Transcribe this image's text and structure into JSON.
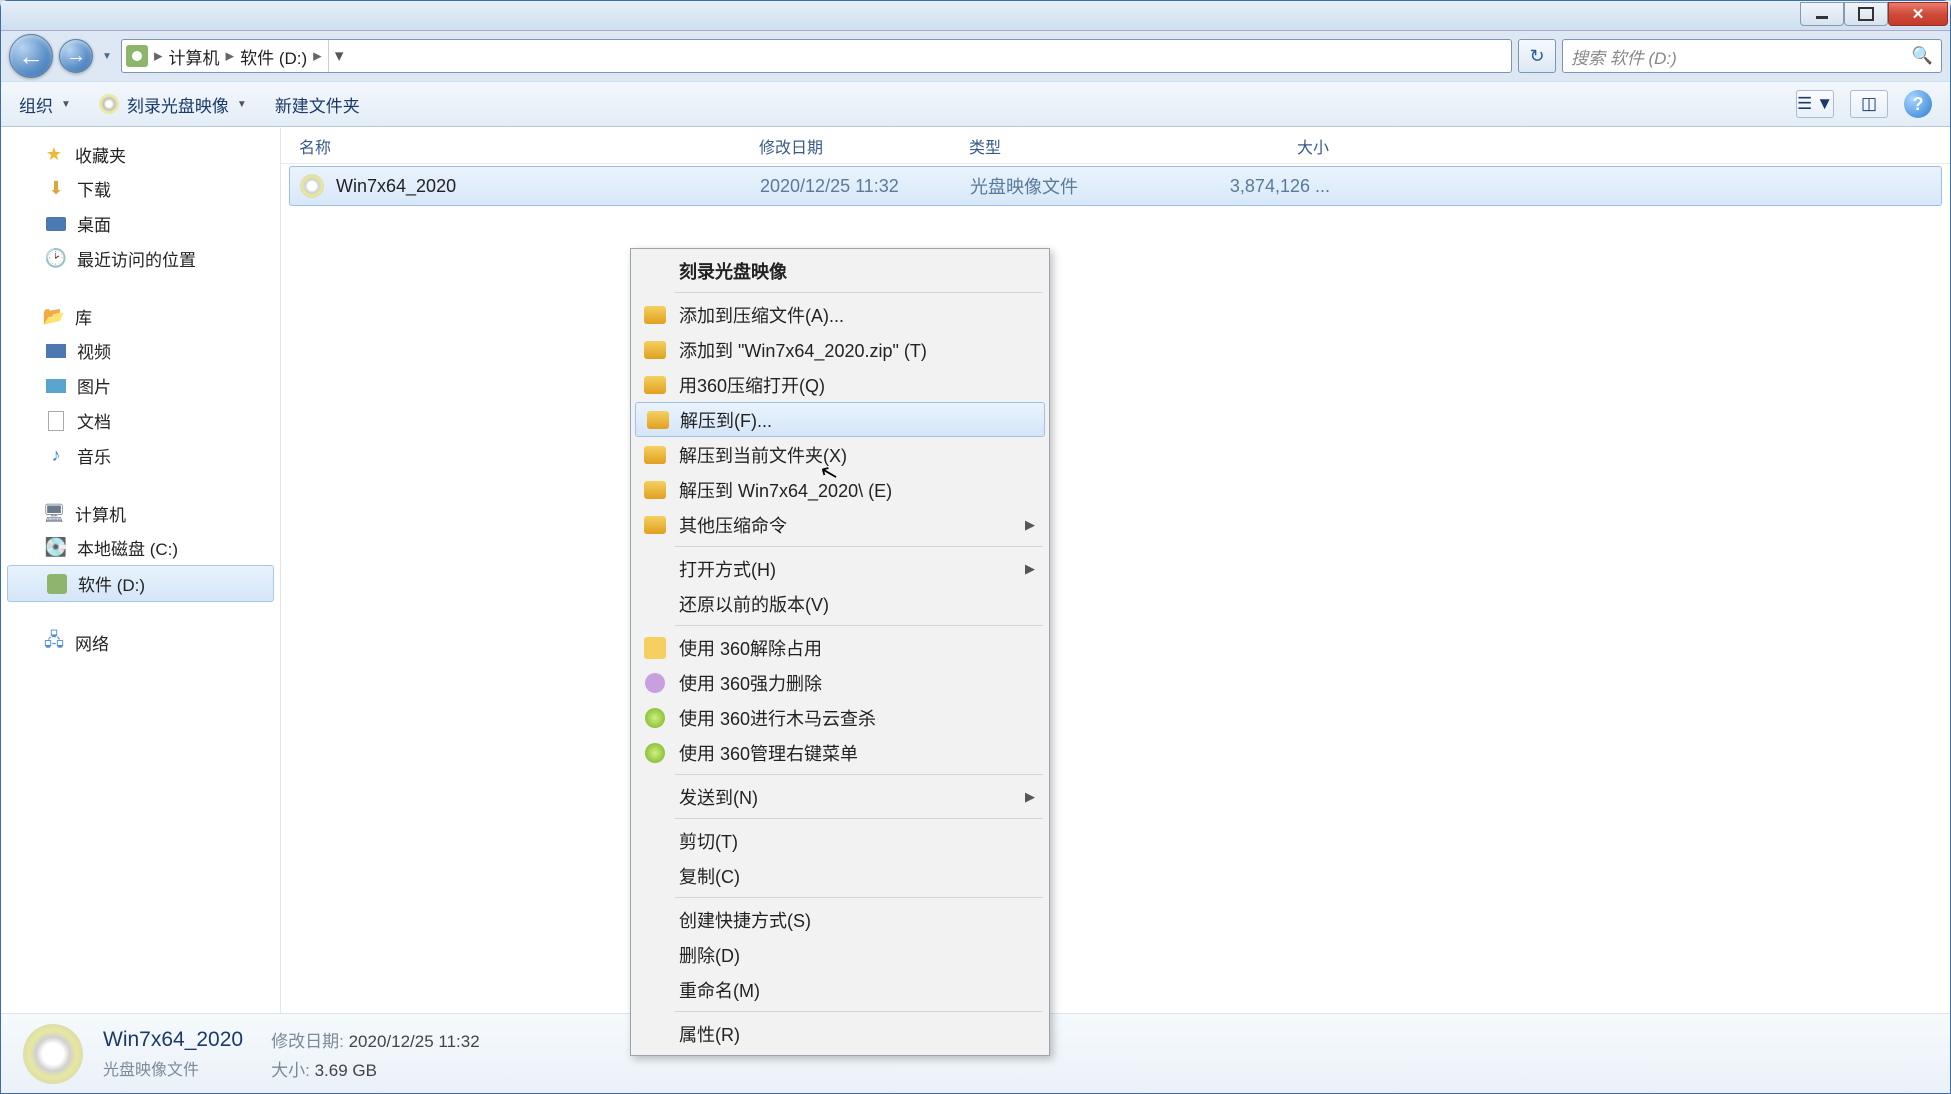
{
  "breadcrumb": {
    "root": "计算机",
    "folder": "软件 (D:)"
  },
  "search": {
    "placeholder": "搜索 软件 (D:)"
  },
  "toolbar": {
    "organize": "组织",
    "burn": "刻录光盘映像",
    "newfolder": "新建文件夹"
  },
  "sidebar": {
    "favorites": "收藏夹",
    "downloads": "下载",
    "desktop": "桌面",
    "recent": "最近访问的位置",
    "libraries": "库",
    "videos": "视频",
    "pictures": "图片",
    "documents": "文档",
    "music": "音乐",
    "computer": "计算机",
    "drive_c": "本地磁盘 (C:)",
    "drive_d": "软件 (D:)",
    "network": "网络"
  },
  "columns": {
    "name": "名称",
    "date": "修改日期",
    "type": "类型",
    "size": "大小"
  },
  "file": {
    "name": "Win7x64_2020",
    "date": "2020/12/25 11:32",
    "type": "光盘映像文件",
    "size": "3,874,126 ..."
  },
  "ctx": {
    "burn": "刻录光盘映像",
    "addArchive": "添加到压缩文件(A)...",
    "addZip": "添加到 \"Win7x64_2020.zip\" (T)",
    "openWith360zip": "用360压缩打开(Q)",
    "extractTo": "解压到(F)...",
    "extractHere": "解压到当前文件夹(X)",
    "extractToFolder": "解压到 Win7x64_2020\\ (E)",
    "otherZip": "其他压缩命令",
    "openWith": "打开方式(H)",
    "restorePrev": "还原以前的版本(V)",
    "use360unlock": "使用 360解除占用",
    "use360force": "使用 360强力删除",
    "use360scan": "使用 360进行木马云查杀",
    "use360menu": "使用 360管理右键菜单",
    "sendTo": "发送到(N)",
    "cut": "剪切(T)",
    "copy": "复制(C)",
    "shortcut": "创建快捷方式(S)",
    "delete": "删除(D)",
    "rename": "重命名(M)",
    "props": "属性(R)"
  },
  "details": {
    "name": "Win7x64_2020",
    "type": "光盘映像文件",
    "dateLabel": "修改日期:",
    "date": "2020/12/25 11:32",
    "sizeLabel": "大小:",
    "size": "3.69 GB"
  }
}
